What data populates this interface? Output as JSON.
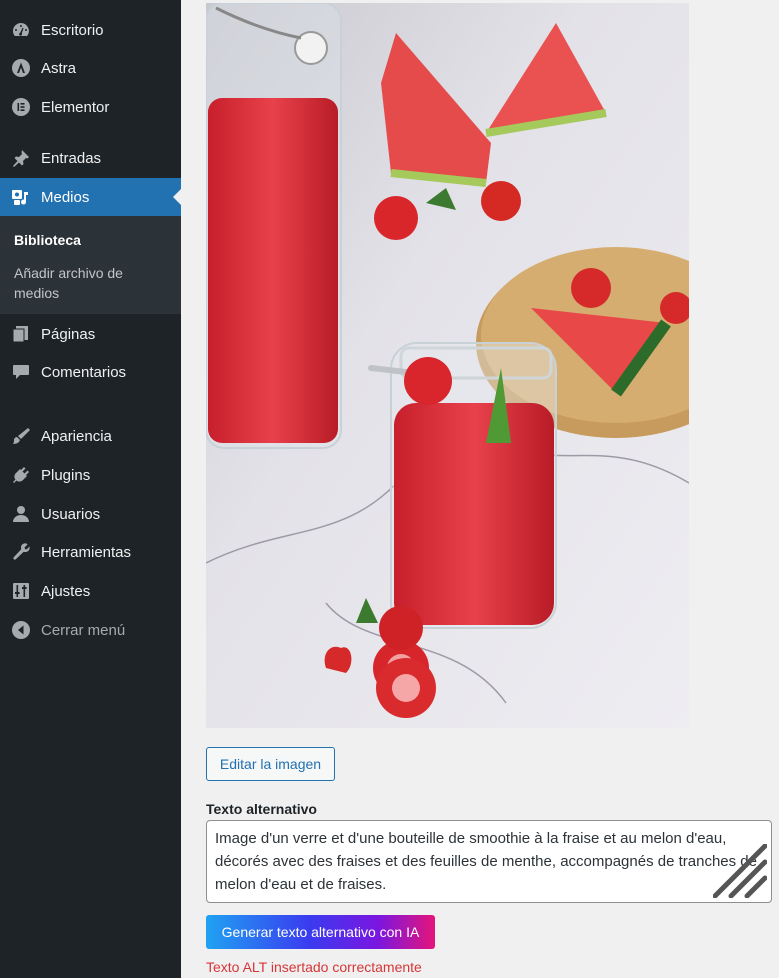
{
  "sidebar": {
    "items": [
      {
        "label": "Escritorio",
        "icon": "dashboard-icon"
      },
      {
        "label": "Astra",
        "icon": "astra-icon"
      },
      {
        "label": "Elementor",
        "icon": "elementor-icon"
      },
      {
        "label": "Entradas",
        "icon": "pin-icon"
      },
      {
        "label": "Medios",
        "icon": "media-icon"
      },
      {
        "label": "Páginas",
        "icon": "pages-icon"
      },
      {
        "label": "Comentarios",
        "icon": "comment-icon"
      },
      {
        "label": "Apariencia",
        "icon": "brush-icon"
      },
      {
        "label": "Plugins",
        "icon": "plugin-icon"
      },
      {
        "label": "Usuarios",
        "icon": "user-icon"
      },
      {
        "label": "Herramientas",
        "icon": "wrench-icon"
      },
      {
        "label": "Ajustes",
        "icon": "settings-icon"
      },
      {
        "label": "Cerrar menú",
        "icon": "collapse-icon"
      }
    ],
    "active": "Medios",
    "submenu": {
      "current": "Biblioteca",
      "link": "Añadir archivo de medios"
    }
  },
  "main": {
    "edit_button": "Editar la imagen",
    "alt_label": "Texto alternativo",
    "alt_value": "Image d'un verre et d'une bouteille de smoothie à la fraise et au melon d'eau, décorés avec des fraises et des feuilles de menthe, accompagnés de tranches de melon d'eau et de fraises.",
    "ai_button": "Generar texto alternativo con IA",
    "status_message": "Texto ALT insertado correctamente"
  },
  "colors": {
    "sidebar_bg": "#1d2327",
    "accent": "#2271b1",
    "error_text": "#d63638"
  }
}
